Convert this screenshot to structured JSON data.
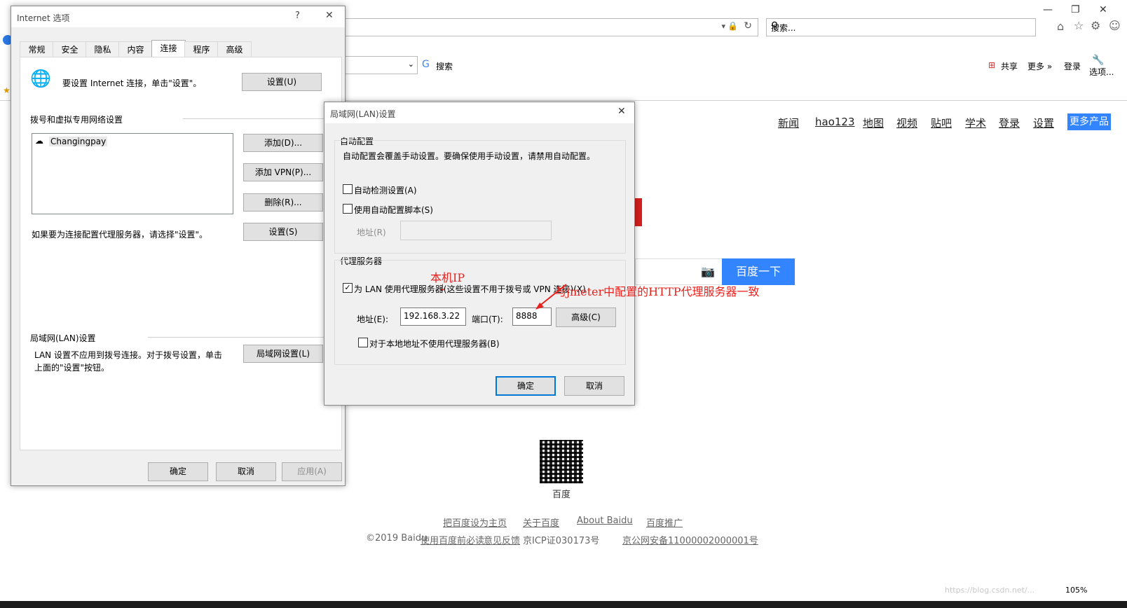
{
  "browser": {
    "search_placeholder": "搜索...",
    "toolbar": {
      "search_label": "搜索",
      "share_label": "共享",
      "more_label": "更多 »",
      "login_label": "登录",
      "options_label": "选项..."
    },
    "nav_links": [
      "新闻",
      "hao123",
      "地图",
      "视频",
      "贴吧",
      "学术",
      "登录",
      "设置"
    ],
    "more_products": "更多产品",
    "baidu_button": "百度一下",
    "qr_caption": "百度",
    "footer_links": [
      "把百度设为主页",
      "关于百度",
      "About  Baidu",
      "百度推广"
    ],
    "footer_copyright": "©2019 Baidu",
    "footer_items": [
      "使用百度前必读",
      "意见反馈",
      "京ICP证030173号",
      "京公网安备11000002000001号"
    ],
    "zoom": "105%",
    "watermark": "https://blog.csdn.net/..."
  },
  "internet_options": {
    "title": "Internet 选项",
    "help_glyph": "?",
    "close_glyph": "✕",
    "tabs": [
      "常规",
      "安全",
      "隐私",
      "内容",
      "连接",
      "程序",
      "高级"
    ],
    "active_tab": "连接",
    "setup_text": "要设置 Internet 连接，单击\"设置\"。",
    "setup_button": "设置(U)",
    "dialup_group": "拨号和虚拟专用网络设置",
    "connection_item": "Changingpay",
    "add_button": "添加(D)...",
    "add_vpn_button": "添加 VPN(P)...",
    "remove_button": "删除(R)...",
    "proxy_hint": "如果要为连接配置代理服务器，请选择\"设置\"。",
    "settings_button": "设置(S)",
    "lan_group": "局域网(LAN)设置",
    "lan_text_1": "LAN 设置不应用到拨号连接。对于拨号设置，单击",
    "lan_text_2": "上面的\"设置\"按钮。",
    "lan_button": "局域网设置(L)",
    "ok_button": "确定",
    "cancel_button": "取消",
    "apply_button": "应用(A)"
  },
  "lan_dialog": {
    "title": "局域网(LAN)设置",
    "close_glyph": "✕",
    "auto_group": "自动配置",
    "auto_desc": "自动配置会覆盖手动设置。要确保使用手动设置，请禁用自动配置。",
    "auto_detect": "自动检测设置(A)",
    "auto_detect_checked": false,
    "use_script": "使用自动配置脚本(S)",
    "use_script_checked": false,
    "script_address_label": "地址(R)",
    "script_address_value": "",
    "proxy_group": "代理服务器",
    "use_proxy": "为 LAN 使用代理服务器(这些设置不用于拨号或 VPN 连接)(X)",
    "use_proxy_checked": true,
    "address_label": "地址(E):",
    "address_value": "192.168.3.22",
    "port_label": "端口(T):",
    "port_value": "8888",
    "advanced_button": "高级(C)",
    "bypass_local": "对于本地地址不使用代理服务器(B)",
    "bypass_local_checked": false,
    "ok_button": "确定",
    "cancel_button": "取消"
  },
  "annotations": {
    "local_ip": "本机IP",
    "jmeter_note": "与jmeter中配置的HTTP代理服务器一致",
    "color": "#e8211d"
  }
}
